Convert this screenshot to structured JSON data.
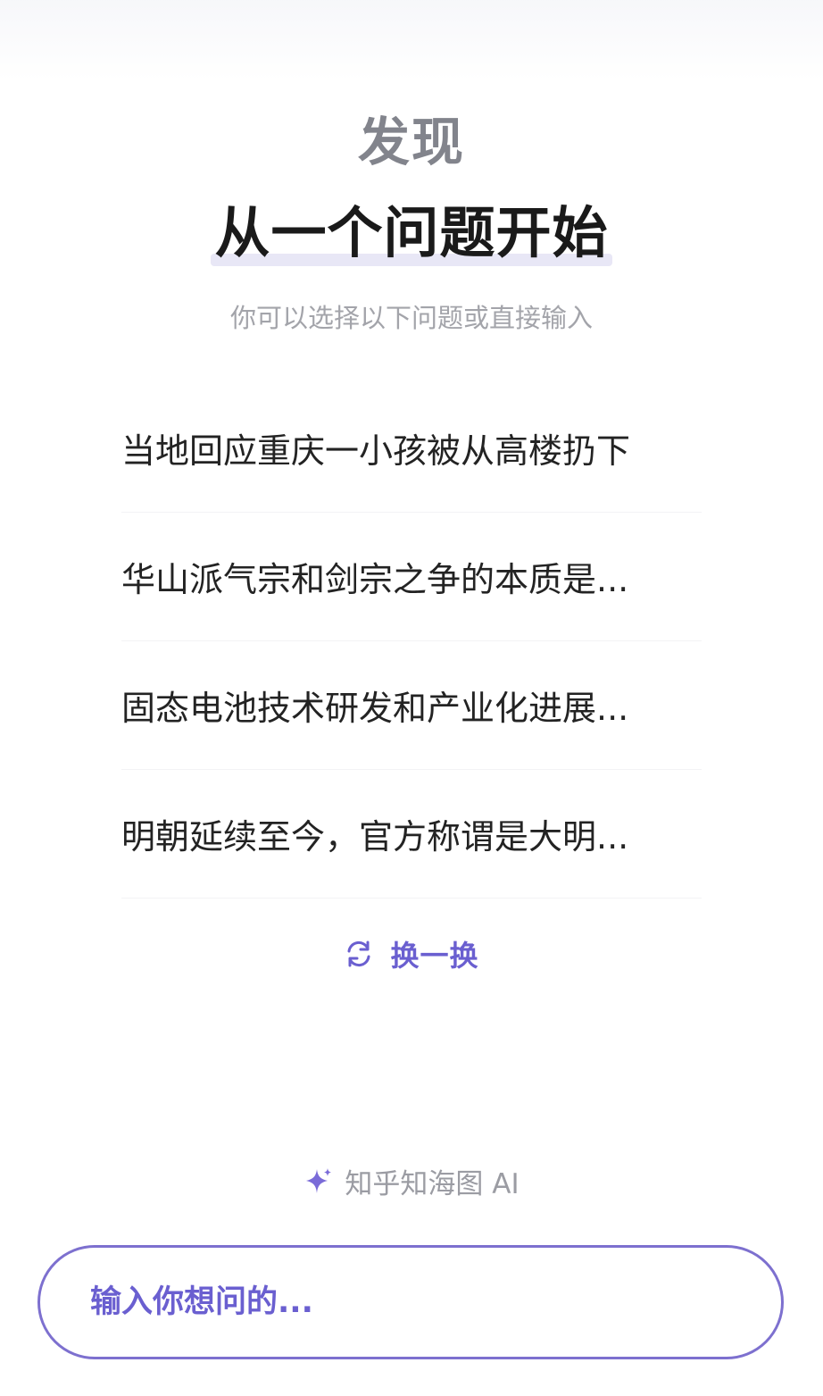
{
  "header": {
    "kicker": "发现",
    "headline": "从一个问题开始",
    "subtitle": "你可以选择以下问题或直接输入"
  },
  "questions": [
    "当地回应重庆一小孩被从高楼扔下",
    "华山派气宗和剑宗之争的本质是...",
    "固态电池技术研发和产业化进展...",
    "明朝延续至今，官方称谓是大明..."
  ],
  "refresh": {
    "label": "换一换",
    "icon": "refresh-icon"
  },
  "brand": {
    "label": "知乎知海图 AI",
    "icon": "sparkle-icon"
  },
  "search": {
    "placeholder": "输入你想问的..."
  },
  "colors": {
    "accent": "#6a5fd0",
    "input_border": "#7d70cf",
    "kicker": "#82848c",
    "headline": "#1a1a1a",
    "muted": "#a3a4aa"
  }
}
